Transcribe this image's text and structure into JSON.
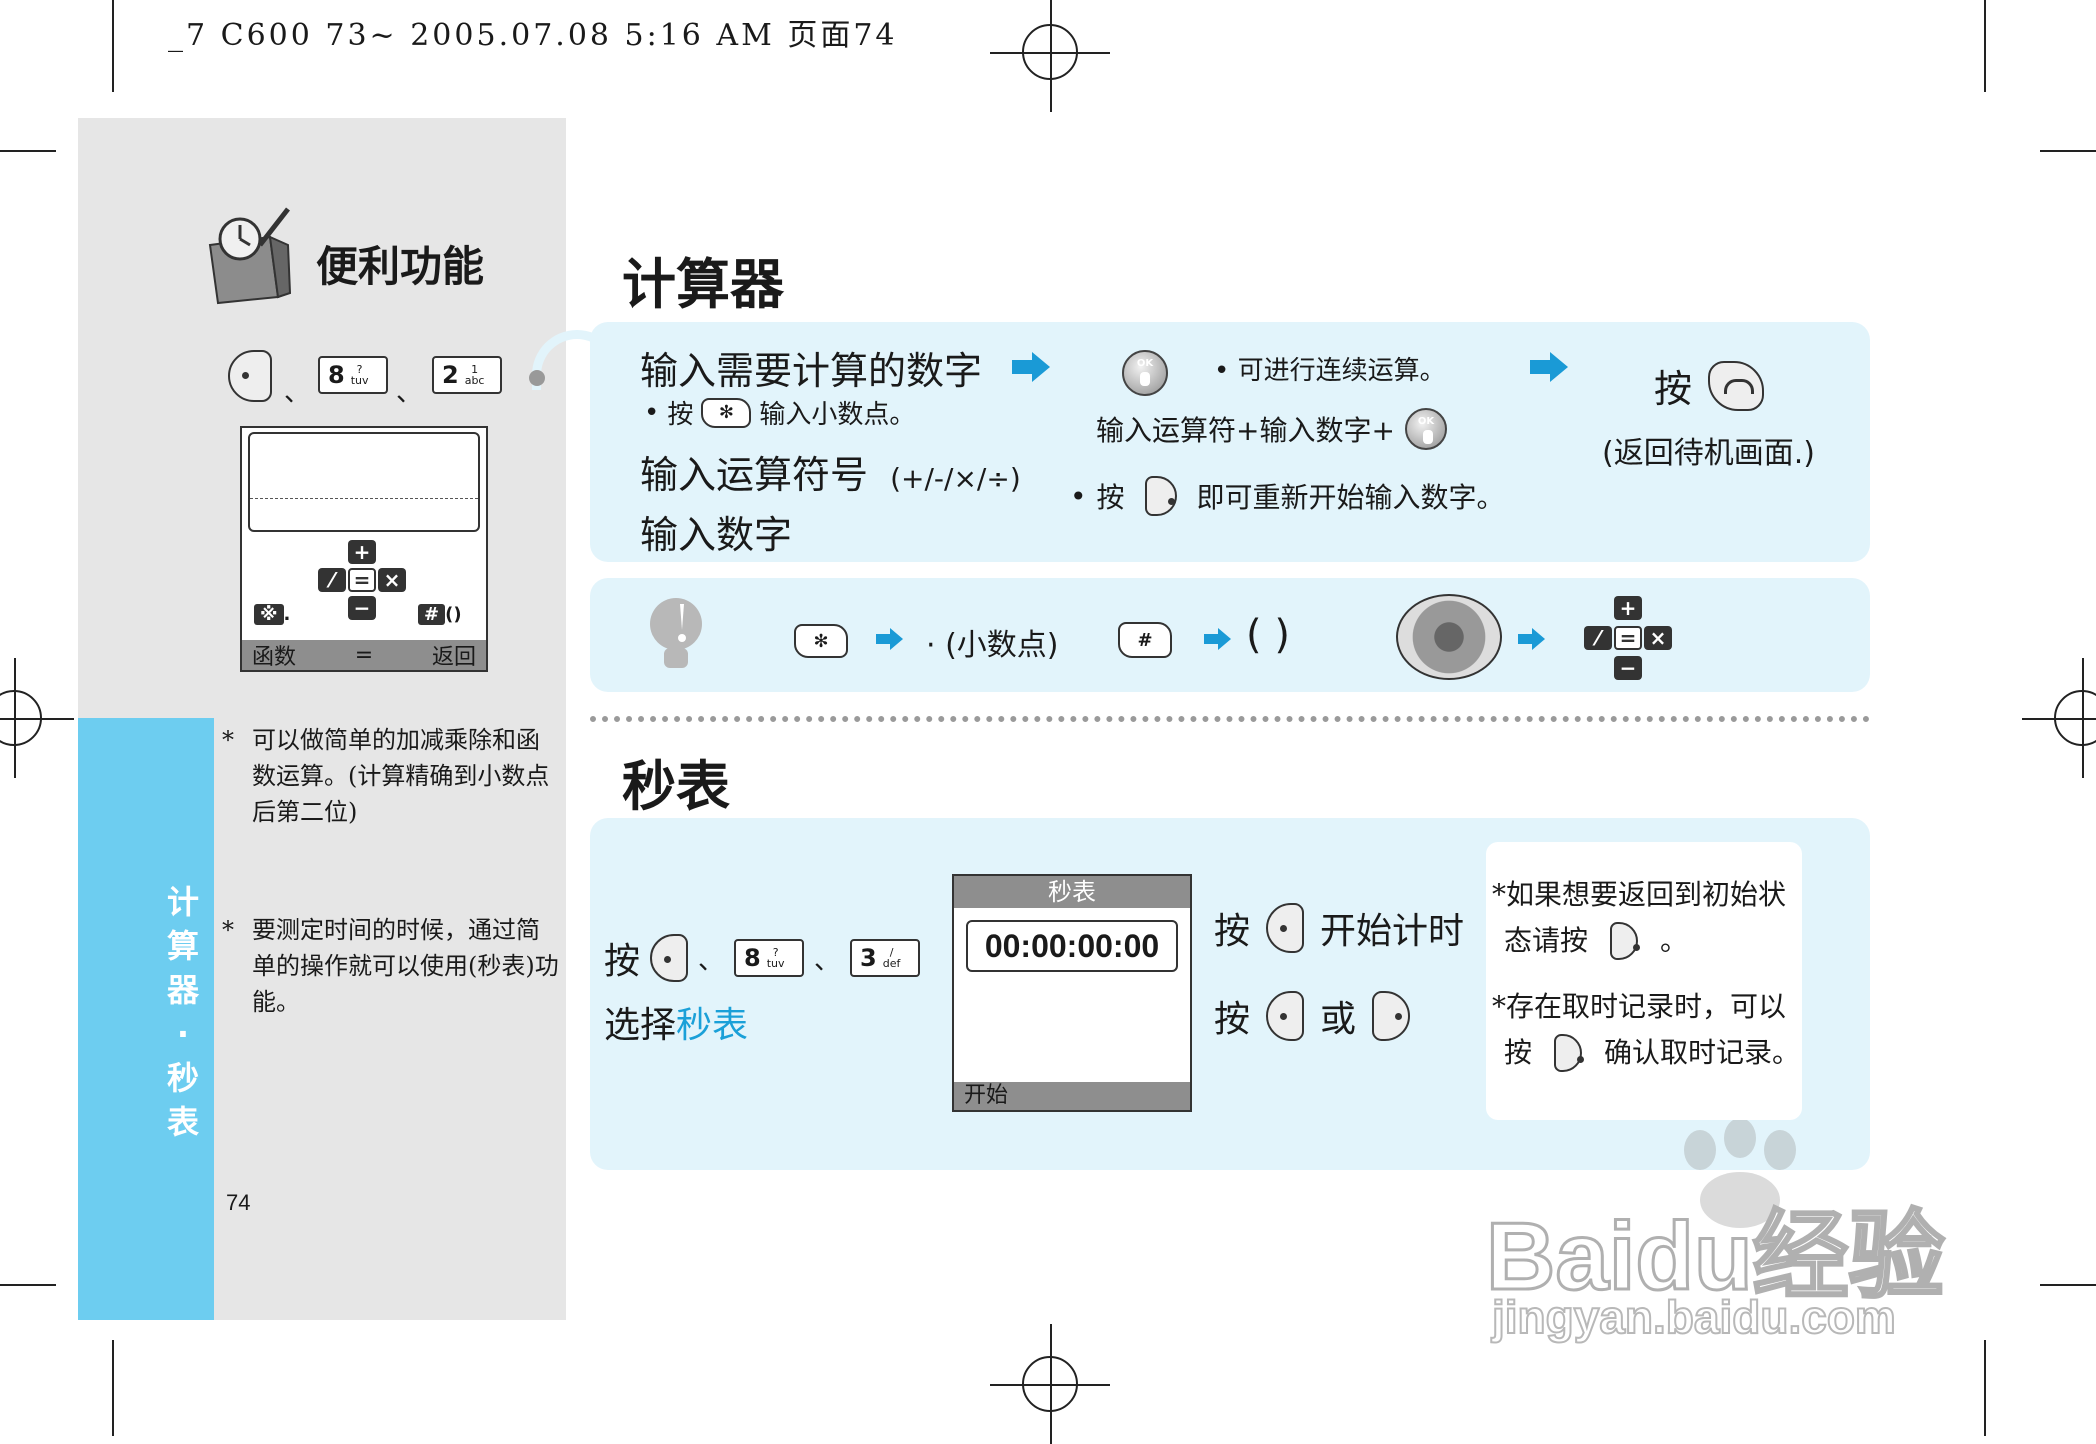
{
  "print_header": "_7 C600 73~ 2005.07.08 5:16 AM 页面74",
  "sidebar": {
    "section_title": "便利功能",
    "nav_sep1": "、",
    "nav_sep2": "、",
    "key8": {
      "digit": "8",
      "sub": "?\ntuv"
    },
    "key2": {
      "digit": "2",
      "sub": "1\nabc"
    },
    "phone_screen": {
      "softkey_left": "函数",
      "softkey_mid": "=",
      "softkey_right": "返回",
      "key_star": "※",
      "key_star_after": ".",
      "key_hash": "#",
      "key_hash_after": "()"
    },
    "note1": "可以做简单的加减乘除和函数运算。(计算精确到小数点后第二位)",
    "note2": "要测定时间的时候，通过简单的操作就可以使用(秒表)功能。",
    "vertical_title": [
      "计",
      "算",
      "器",
      "·",
      "秒",
      "表"
    ],
    "page_number": "74"
  },
  "calculator": {
    "heading": "计算器",
    "step1": "输入需要计算的数字",
    "step1_press": "按",
    "step1_decimal": "输入小数点。",
    "step2": "输入运算符号",
    "step2_ops": "(+/-/×/÷)",
    "step3": "输入数字",
    "cont_note": "可进行连续运算。",
    "cont_line": "输入运算符+输入数字+",
    "reset_press": "按",
    "reset_note": "即可重新开始输入数字。",
    "end_press": "按",
    "end_note": "(返回待机画面.)",
    "ok": "OK"
  },
  "tip": {
    "decimal": "· (小数点)",
    "parens": "( )"
  },
  "stopwatch": {
    "heading": "秒表",
    "press": "按",
    "sep1": "、",
    "sep2": "、",
    "key8": {
      "digit": "8",
      "sub": "?\ntuv"
    },
    "key3": {
      "digit": "3",
      "sub": "/\ndef"
    },
    "select": "选择",
    "select_target": "秒表",
    "screen_title": "秒表",
    "time": "00:00:00:00",
    "screen_softkey": "开始",
    "start_press": "按",
    "start_label": "开始计时",
    "or_press": "按",
    "or_label": "或",
    "note1a": "*如果想要返回到初始状",
    "note1b": "态请按",
    "note1c": "。",
    "note2a": "*存在取时记录时，可以",
    "note2b": "按",
    "note2c": "确认取时记录。"
  },
  "watermark": {
    "brand": "Baidu经验",
    "url": "jingyan.baidu.com"
  }
}
